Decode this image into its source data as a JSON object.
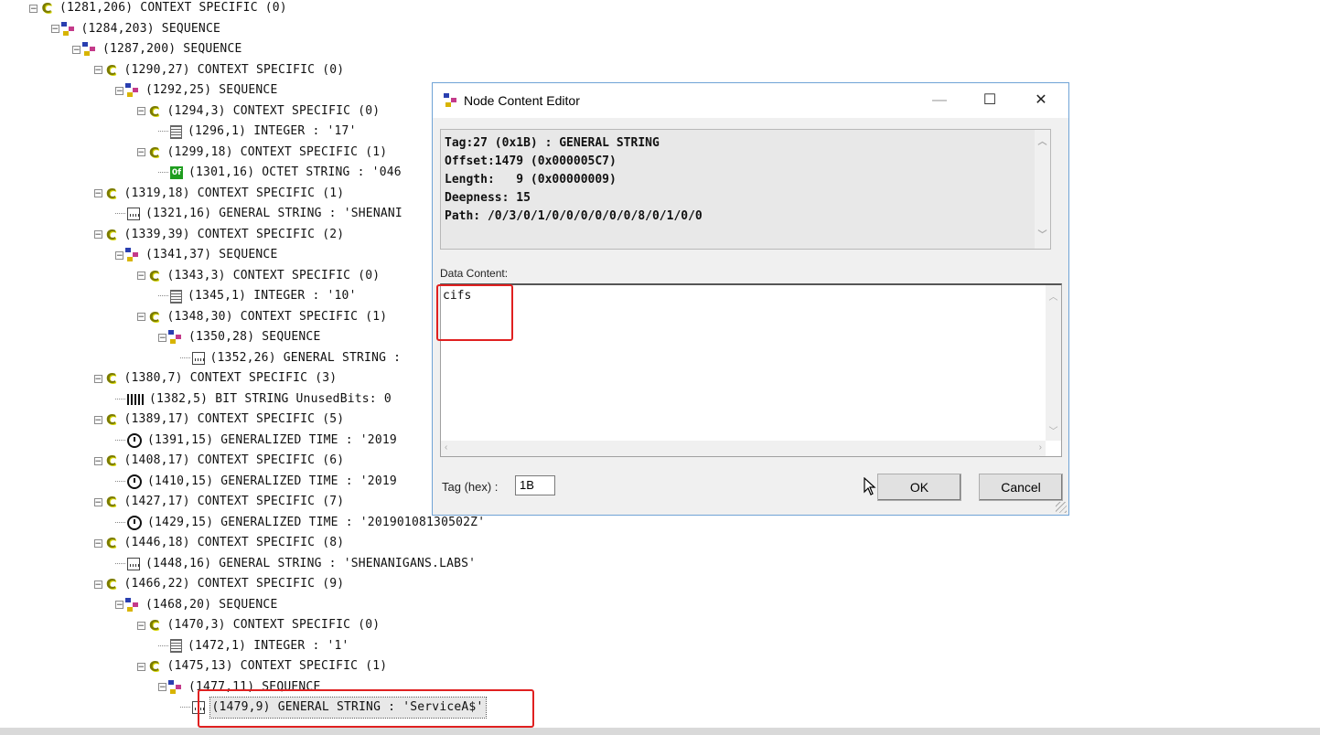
{
  "tree": [
    {
      "depth": 0,
      "expander": "minus",
      "icon": "context-icon",
      "label": "(1281,206) CONTEXT SPECIFIC (0)"
    },
    {
      "depth": 1,
      "expander": "minus",
      "icon": "sequence-icon",
      "label": "(1284,203) SEQUENCE"
    },
    {
      "depth": 2,
      "expander": "minus",
      "icon": "sequence-icon",
      "label": "(1287,200) SEQUENCE"
    },
    {
      "depth": 3,
      "expander": "minus",
      "icon": "context-icon",
      "label": "(1290,27) CONTEXT SPECIFIC (0)"
    },
    {
      "depth": 4,
      "expander": "minus",
      "icon": "sequence-icon",
      "label": "(1292,25) SEQUENCE"
    },
    {
      "depth": 5,
      "expander": "minus",
      "icon": "context-icon",
      "label": "(1294,3) CONTEXT SPECIFIC (0)"
    },
    {
      "depth": 6,
      "expander": "leaf",
      "icon": "integer-icon",
      "label": "(1296,1) INTEGER : '17'"
    },
    {
      "depth": 5,
      "expander": "minus",
      "icon": "context-icon",
      "label": "(1299,18) CONTEXT SPECIFIC (1)"
    },
    {
      "depth": 6,
      "expander": "leaf",
      "icon": "octet-string-icon",
      "label": "(1301,16) OCTET STRING : '046"
    },
    {
      "depth": 3,
      "expander": "minus",
      "icon": "context-icon",
      "label": "(1319,18) CONTEXT SPECIFIC (1)"
    },
    {
      "depth": 4,
      "expander": "leaf",
      "icon": "general-string-icon",
      "label": "(1321,16) GENERAL STRING : 'SHENANI"
    },
    {
      "depth": 3,
      "expander": "minus",
      "icon": "context-icon",
      "label": "(1339,39) CONTEXT SPECIFIC (2)"
    },
    {
      "depth": 4,
      "expander": "minus",
      "icon": "sequence-icon",
      "label": "(1341,37) SEQUENCE"
    },
    {
      "depth": 5,
      "expander": "minus",
      "icon": "context-icon",
      "label": "(1343,3) CONTEXT SPECIFIC (0)"
    },
    {
      "depth": 6,
      "expander": "leaf",
      "icon": "integer-icon",
      "label": "(1345,1) INTEGER : '10'"
    },
    {
      "depth": 5,
      "expander": "minus",
      "icon": "context-icon",
      "label": "(1348,30) CONTEXT SPECIFIC (1)"
    },
    {
      "depth": 6,
      "expander": "minus",
      "icon": "sequence-icon",
      "label": "(1350,28) SEQUENCE"
    },
    {
      "depth": 7,
      "expander": "leaf",
      "icon": "general-string-icon",
      "label": "(1352,26) GENERAL STRING :"
    },
    {
      "depth": 3,
      "expander": "minus",
      "icon": "context-icon",
      "label": "(1380,7) CONTEXT SPECIFIC (3)"
    },
    {
      "depth": 4,
      "expander": "leaf",
      "icon": "bit-string-icon",
      "label": "(1382,5) BIT STRING UnusedBits: 0"
    },
    {
      "depth": 3,
      "expander": "minus",
      "icon": "context-icon",
      "label": "(1389,17) CONTEXT SPECIFIC (5)"
    },
    {
      "depth": 4,
      "expander": "leaf",
      "icon": "clock-icon",
      "label": "(1391,15) GENERALIZED TIME : '2019"
    },
    {
      "depth": 3,
      "expander": "minus",
      "icon": "context-icon",
      "label": "(1408,17) CONTEXT SPECIFIC (6)"
    },
    {
      "depth": 4,
      "expander": "leaf",
      "icon": "clock-icon",
      "label": "(1410,15) GENERALIZED TIME : '2019"
    },
    {
      "depth": 3,
      "expander": "minus",
      "icon": "context-icon",
      "label": "(1427,17) CONTEXT SPECIFIC (7)"
    },
    {
      "depth": 4,
      "expander": "leaf",
      "icon": "clock-icon",
      "label": "(1429,15) GENERALIZED TIME : '20190108130502Z'"
    },
    {
      "depth": 3,
      "expander": "minus",
      "icon": "context-icon",
      "label": "(1446,18) CONTEXT SPECIFIC (8)"
    },
    {
      "depth": 4,
      "expander": "leaf",
      "icon": "general-string-icon",
      "label": "(1448,16) GENERAL STRING : 'SHENANIGANS.LABS'"
    },
    {
      "depth": 3,
      "expander": "minus",
      "icon": "context-icon",
      "label": "(1466,22) CONTEXT SPECIFIC (9)"
    },
    {
      "depth": 4,
      "expander": "minus",
      "icon": "sequence-icon",
      "label": "(1468,20) SEQUENCE"
    },
    {
      "depth": 5,
      "expander": "minus",
      "icon": "context-icon",
      "label": "(1470,3) CONTEXT SPECIFIC (0)"
    },
    {
      "depth": 6,
      "expander": "leaf",
      "icon": "integer-icon",
      "label": "(1472,1) INTEGER : '1'"
    },
    {
      "depth": 5,
      "expander": "minus",
      "icon": "context-icon",
      "label": "(1475,13) CONTEXT SPECIFIC (1)"
    },
    {
      "depth": 6,
      "expander": "minus",
      "icon": "sequence-icon",
      "label": "(1477,11) SEQUENCE"
    },
    {
      "depth": 7,
      "expander": "leaf",
      "icon": "general-string-icon",
      "label": "(1479,9) GENERAL STRING : 'ServiceA$'",
      "selected": true
    }
  ],
  "dialog": {
    "title": "Node Content Editor",
    "minimize": "—",
    "maximize": "☐",
    "close": "✕",
    "info_lines": [
      "Tag:27 (0x1B) : GENERAL STRING",
      "Offset:1479 (0x000005C7)",
      "Length:   9 (0x00000009)",
      "Deepness: 15",
      "Path: /0/3/0/1/0/0/0/0/0/0/8/0/1/0/0"
    ],
    "data_content_label": "Data Content:",
    "data_content_value": "cifs",
    "tag_hex_label": "Tag (hex) :",
    "tag_hex_value": "1B",
    "ok_label": "OK",
    "cancel_label": "Cancel"
  },
  "colors": {
    "highlight_red": "#e02020",
    "dialog_border": "#6fa3d6",
    "context_icon": "#7b7b00",
    "octet_icon": "#1f9d1f"
  }
}
